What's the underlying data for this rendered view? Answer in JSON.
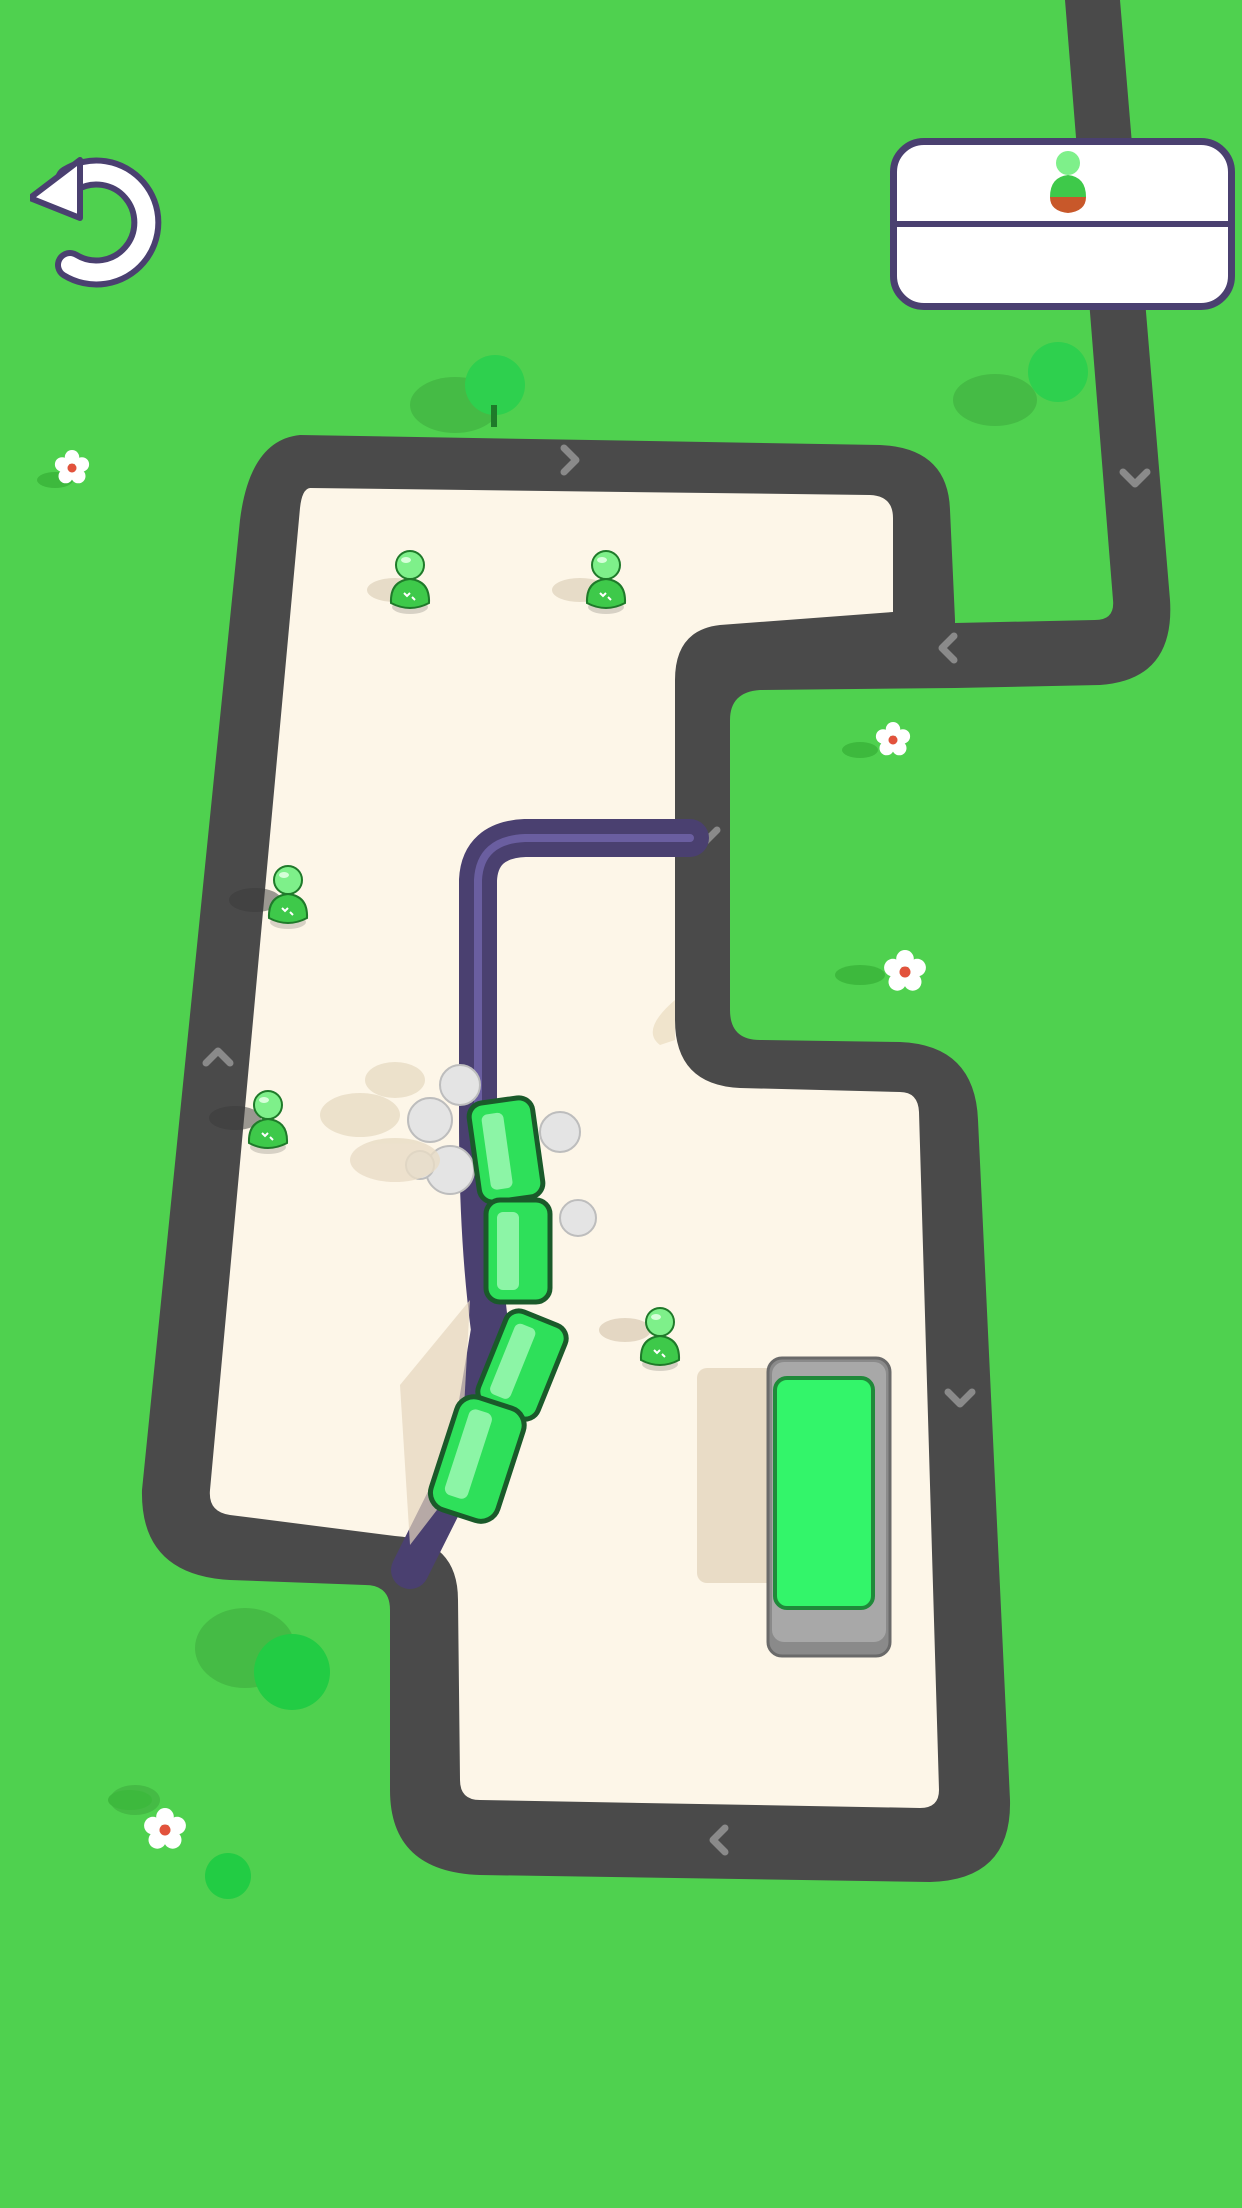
{
  "screen": {
    "name": "train-path-puzzle-level",
    "background_color": "#4fd14f",
    "road_color": "#4a4a4a",
    "platform_color": "#fdf6e8",
    "drawn_path_color": "#4a4070",
    "train_color": "#2ee05a",
    "station_color": "#33f56a"
  },
  "toolbar": {
    "undo_icon": "undo-arrow-icon"
  },
  "passenger_panel": {
    "slots": [
      {
        "icon": "green-passenger-icon",
        "occupied": true
      },
      {
        "icon": "",
        "occupied": false
      }
    ]
  },
  "level": {
    "train_cars": 4,
    "passengers_waiting": 6,
    "road_arrows": [
      "right",
      "down",
      "left",
      "down",
      "up",
      "down",
      "left"
    ]
  }
}
